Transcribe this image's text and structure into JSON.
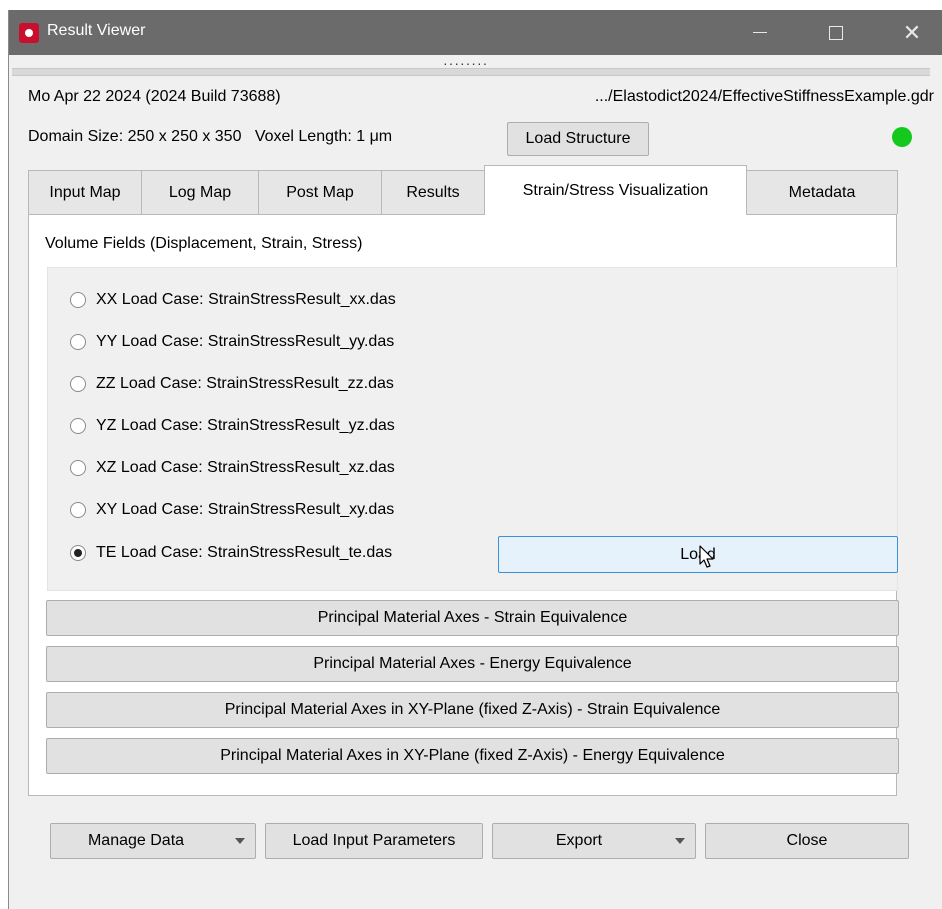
{
  "window": {
    "title": "Result Viewer",
    "controls": {
      "minimize": "minimize-icon",
      "maximize": "maximize-icon",
      "close": "close-icon"
    }
  },
  "info": {
    "date_build": "Mo Apr 22 2024 (2024 Build 73688)",
    "file_path": ".../Elastodict2024/EffectiveStiffnessExample.gdr",
    "domain_size": "Domain Size: 250 x 250 x 350",
    "voxel_length": "Voxel Length: 1 μm",
    "load_structure_label": "Load Structure",
    "status_color": "#14c81e"
  },
  "tabs": [
    {
      "label": "Input Map"
    },
    {
      "label": "Log Map"
    },
    {
      "label": "Post Map"
    },
    {
      "label": "Results"
    },
    {
      "label": "Strain/Stress Visualization",
      "active": true
    },
    {
      "label": "Metadata"
    }
  ],
  "panel": {
    "section_title": "Volume Fields (Displacement, Strain, Stress)",
    "load_cases": [
      {
        "label": "XX Load Case: StrainStressResult_xx.das",
        "checked": false
      },
      {
        "label": "YY Load Case: StrainStressResult_yy.das",
        "checked": false
      },
      {
        "label": "ZZ Load Case: StrainStressResult_zz.das",
        "checked": false
      },
      {
        "label": "YZ Load Case: StrainStressResult_yz.das",
        "checked": false
      },
      {
        "label": "XZ Load Case: StrainStressResult_xz.das",
        "checked": false
      },
      {
        "label": "XY Load Case: StrainStressResult_xy.das",
        "checked": false
      },
      {
        "label": "TE Load Case: StrainStressResult_te.das",
        "checked": true
      }
    ],
    "load_label": "Load",
    "axes_buttons": [
      "Principal Material Axes - Strain Equivalence",
      "Principal Material Axes - Energy Equivalence",
      "Principal Material Axes in XY-Plane (fixed Z-Axis) - Strain Equivalence",
      "Principal Material Axes in XY-Plane (fixed Z-Axis) - Energy Equivalence"
    ]
  },
  "footer": {
    "manage_data": "Manage Data",
    "load_input_parameters": "Load Input Parameters",
    "export": "Export",
    "close": "Close"
  }
}
